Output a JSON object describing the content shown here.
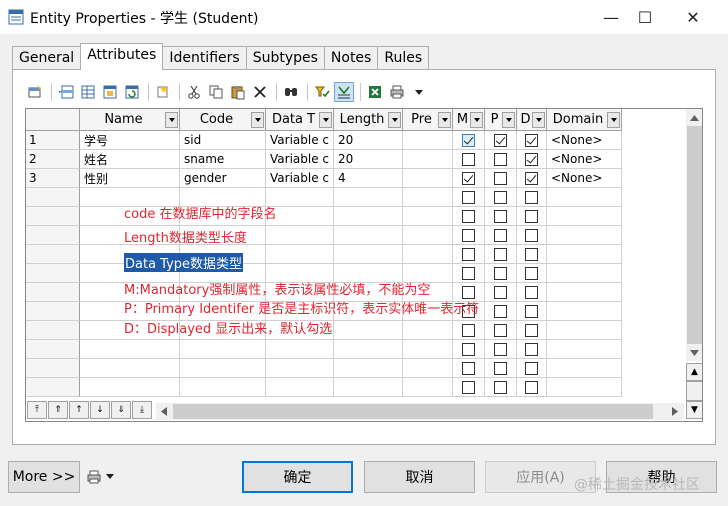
{
  "window": {
    "title": "Entity Properties - 学生 (Student)",
    "minimize": "—",
    "maximize": "☐",
    "close": "✕"
  },
  "tabs": [
    "General",
    "Attributes",
    "Identifiers",
    "Subtypes",
    "Notes",
    "Rules"
  ],
  "active_tab": "Attributes",
  "toolbar_icons": [
    "properties-icon",
    "insert-row-icon",
    "add-row-icon",
    "add-attribute-icon",
    "reuse-attribute-icon",
    "new-icon",
    "cut-icon",
    "copy-icon",
    "paste-icon",
    "delete-icon",
    "find-icon",
    "filter-icon",
    "customize-columns-icon",
    "excel-export-icon",
    "print-icon",
    "dropdown-icon"
  ],
  "grid": {
    "columns": [
      "Name",
      "Code",
      "Data T",
      "Length",
      "Pre",
      "M",
      "P",
      "D",
      "Domain"
    ],
    "rows": [
      {
        "num": "1",
        "name": "学号",
        "code": "sid",
        "data_type": "Variable c",
        "length": "20",
        "precision": "",
        "m": true,
        "p": true,
        "d": true,
        "domain": "<None>"
      },
      {
        "num": "2",
        "name": "姓名",
        "code": "sname",
        "data_type": "Variable c",
        "length": "20",
        "precision": "",
        "m": false,
        "p": false,
        "d": true,
        "domain": "<None>"
      },
      {
        "num": "3",
        "name": "性别",
        "code": "gender",
        "data_type": "Variable c",
        "length": "4",
        "precision": "",
        "m": true,
        "p": false,
        "d": true,
        "domain": "<None>"
      }
    ],
    "empty_rows": 11
  },
  "annotations": {
    "code_note": "code 在数据库中的字段名",
    "length_note": "Length数据类型长度",
    "datatype_note": "Data Type数据类型",
    "m_note": "M:Mandatory强制属性，表示该属性必填，不能为空",
    "p_note": "P：Primary Identifer 是否是主标识符，表示实体唯一表示符",
    "d_note": "D：Displayed 显示出来，默认勾选"
  },
  "buttons": {
    "more": "More >>",
    "ok": "确定",
    "cancel": "取消",
    "apply": "应用(A)",
    "help": "帮助"
  },
  "watermark": "@稀土掘金技术社区",
  "colors": {
    "annotation": "#e0262f",
    "selection": "#1e5aa8",
    "default_button_border": "#0078d7"
  }
}
